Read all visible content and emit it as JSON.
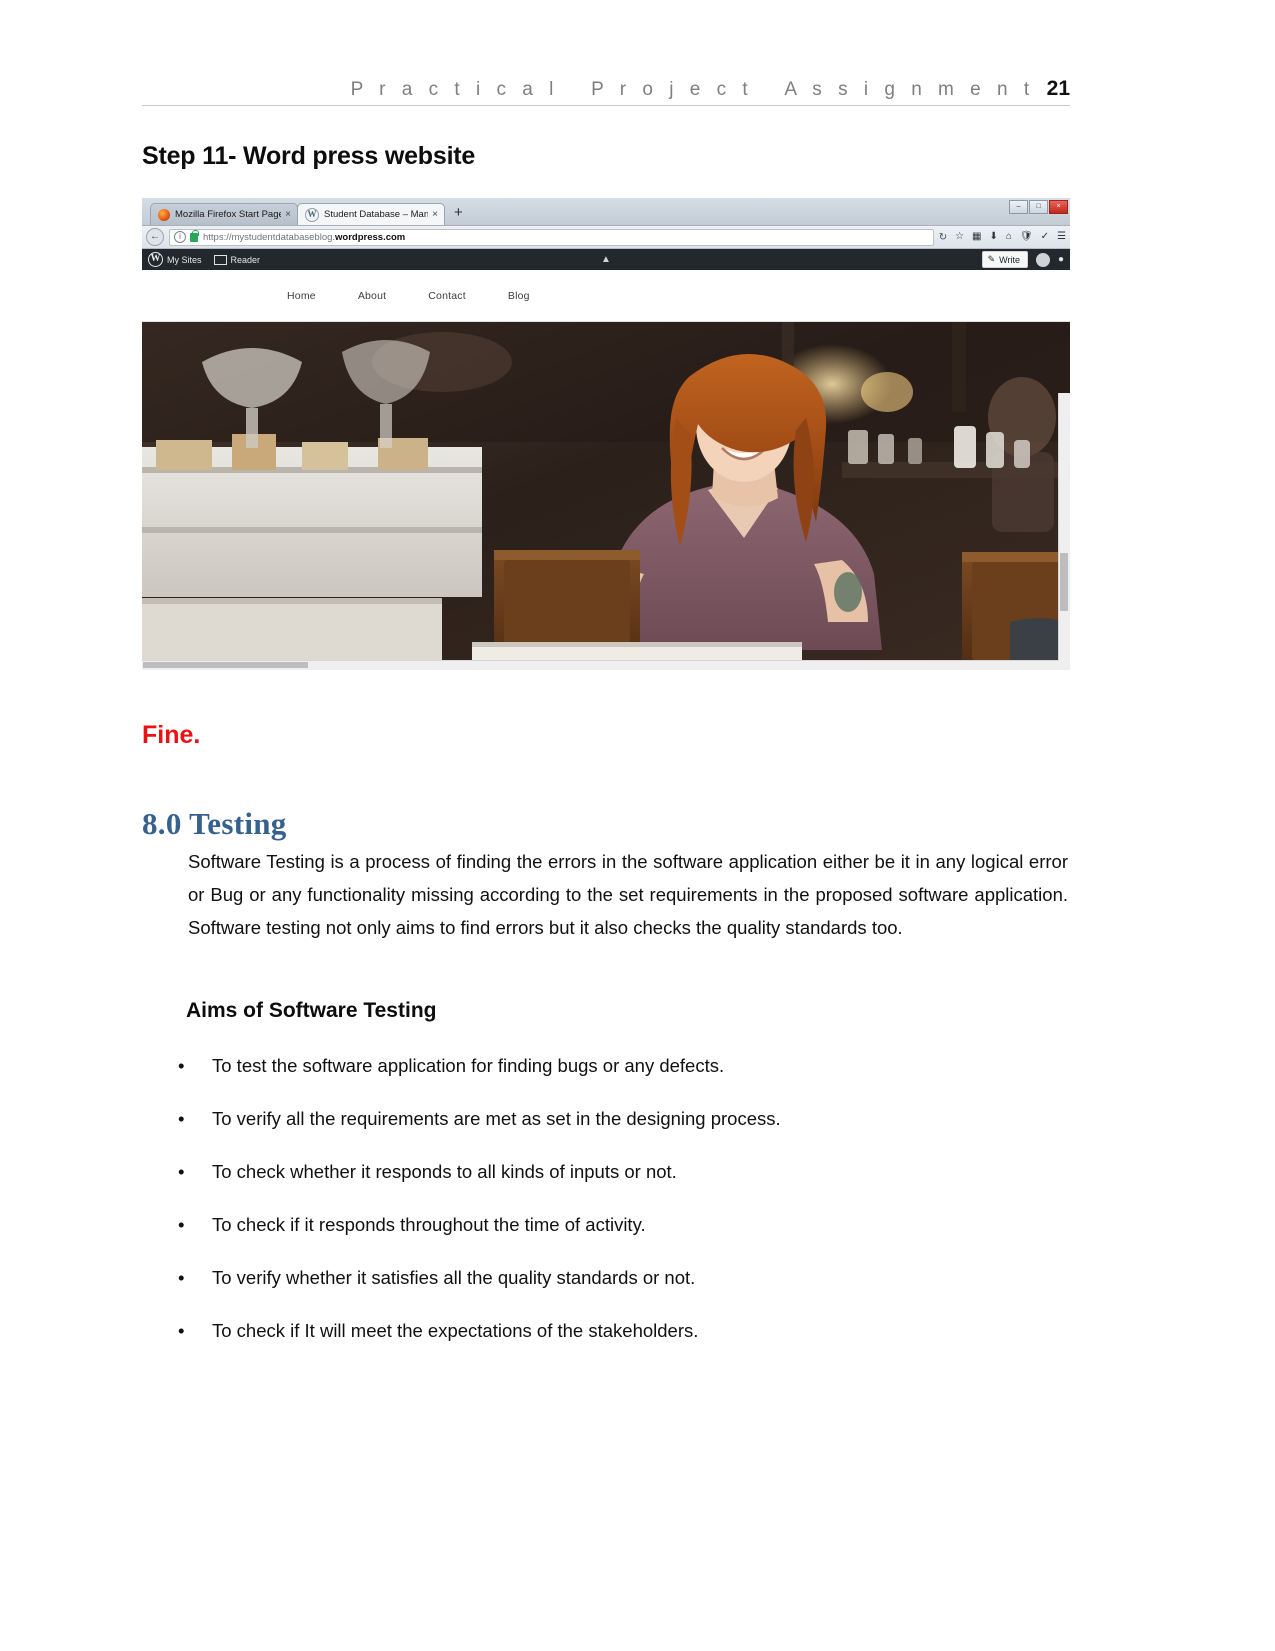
{
  "header": {
    "title": "P r a c t i c a l   P r o j e c t   A s s i g n m e n t",
    "page_number": "21"
  },
  "step_heading": "Step 11- Word press website",
  "browser": {
    "tabs": [
      {
        "label": "Mozilla Firefox Start Page",
        "favicon": "firefox-icon",
        "close": "×",
        "active": false
      },
      {
        "label": "Student Database – Manage",
        "favicon": "wordpress-icon",
        "close": "×",
        "active": true
      }
    ],
    "new_tab_label": "+",
    "window_controls": {
      "minimize": "–",
      "maximize": "□",
      "close": "×"
    },
    "url": {
      "scheme_and_host_dim": "https://mystudentdatabaseblog.",
      "host_strong": "wordpress.com",
      "info_icon": "ⓘ",
      "lock_icon": "lock-icon",
      "reload_icon": "↻"
    },
    "toolbar_icons": [
      "star-icon",
      "library-icon",
      "download-icon",
      "home-icon",
      "shield-icon",
      "pocket-icon",
      "menu-icon"
    ],
    "wp_admin_bar": {
      "logo": "W",
      "my_sites": "My Sites",
      "reader": "Reader",
      "caret": "▲",
      "write_label": "Write",
      "write_icon": "pencil-icon",
      "avatar": "user-avatar",
      "bell": "⬤"
    },
    "site_nav": [
      "Home",
      "About",
      "Contact",
      "Blog"
    ]
  },
  "fine_note": "Fine.",
  "section": {
    "heading": "8.0 Testing",
    "paragraph": "Software Testing is a process of finding the errors in the software application either be it in any logical error or Bug or any functionality missing according to the set requirements in the proposed software application. Software testing not only aims to find errors but it also checks the quality standards too.",
    "aims_heading": "Aims of Software Testing",
    "bullet_marker": "•",
    "bullets": [
      "To test the software application for finding bugs or any defects.",
      "To verify all the requirements are met as set in the designing process.",
      "To check whether it responds to all kinds of inputs or not.",
      "To check if it responds throughout the time of activity.",
      "To verify whether it satisfies all the quality standards or not.",
      "To check if It will meet the expectations of the stakeholders."
    ]
  },
  "colors": {
    "section_heading": "#36618e",
    "fine_note": "#ee1111",
    "header_text": "#7f7f7f",
    "wp_bar": "#23282d"
  }
}
